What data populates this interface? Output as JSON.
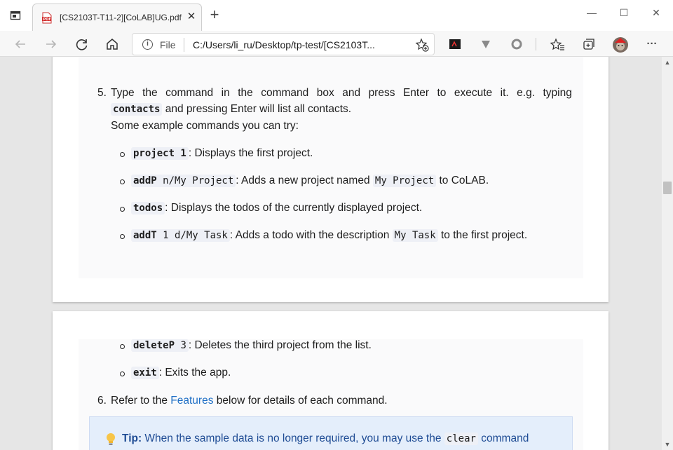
{
  "browser": {
    "tab_title": "[CS2103T-T11-2][CoLAB]UG.pdf",
    "tab_close": "✕",
    "new_tab": "+",
    "file_label": "File",
    "url": "C:/Users/li_ru/Desktop/tp-test/[CS2103T...",
    "minimize": "—",
    "maximize": "☐",
    "close": "✕",
    "more": "···"
  },
  "doc": {
    "step5": {
      "number": "5.",
      "line1_words": [
        "Type",
        "the",
        "command",
        "in",
        "the",
        "command",
        "box",
        "and",
        "press",
        "Enter",
        "to",
        "execute",
        "it.",
        "e.g.",
        "typing"
      ],
      "code_contacts": "contacts",
      "line2_rest": "and pressing Enter will list all contacts.",
      "line3": "Some example commands you can try:"
    },
    "examples": [
      {
        "cmd": "project 1",
        "text": ": Displays the first project."
      },
      {
        "cmd": "addP",
        "arg": " n/My Project",
        "mid": ": Adds a new project named ",
        "code2": "My Project",
        "end": " to CoLAB."
      },
      {
        "cmd": "todos",
        "text": ": Displays the todos of the currently displayed project."
      },
      {
        "cmd": "addT",
        "arg": " 1 d/My Task",
        "mid": ": Adds a todo with the description ",
        "code2": "My Task",
        "end": " to the first project."
      }
    ],
    "page2": {
      "delete_cmd": "deleteP",
      "delete_arg": " 3",
      "delete_text": ": Deletes the third project from the list.",
      "exit_cmd": "exit",
      "exit_text": ": Exits the app.",
      "step6_number": "6.",
      "step6_pre": "Refer to the ",
      "step6_link": "Features",
      "step6_post": " below for details of each command.",
      "tip_label": "Tip:",
      "tip_text": " When the sample data is no longer required, you may use the ",
      "tip_code": "clear",
      "tip_end": " command"
    }
  },
  "colors": {
    "link": "#1f6fc5",
    "tip_bg": "#e4eefb",
    "tip_text": "#1e4b94"
  }
}
